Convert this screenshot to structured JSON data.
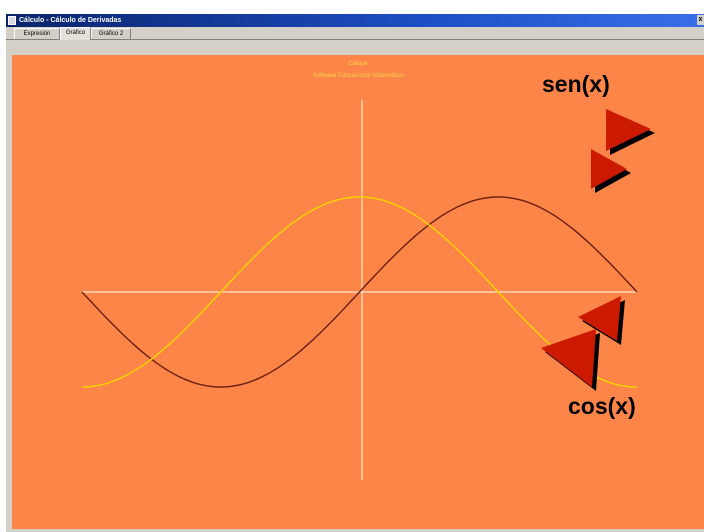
{
  "window": {
    "title": "Cálculo - Cálculo de Derivadas",
    "close_label": "x"
  },
  "tabs": [
    {
      "label": "Expresión",
      "active": false
    },
    {
      "label": "Gráfico",
      "active": true
    },
    {
      "label": "Gráfico 2",
      "active": false
    }
  ],
  "canvas": {
    "header_line1": "Calque",
    "header_line2": "Software Educacional Matemática",
    "background": "#fd8547"
  },
  "labels": {
    "sen": "sen(x)",
    "cos": "cos(x)"
  },
  "colors": {
    "sen_curve": "#6b1f10",
    "cos_curve": "#ffd400",
    "axes": "#ffe6c8",
    "arrow": "#cc1a00",
    "arrow_shadow": "#000000"
  },
  "chart_data": {
    "type": "line",
    "title": "",
    "xlabel": "",
    "ylabel": "",
    "x_range": [
      -3.1416,
      3.1416
    ],
    "y_range": [
      -1,
      1
    ],
    "grid": false,
    "series": [
      {
        "name": "sen(x)",
        "function": "sin"
      },
      {
        "name": "cos(x)",
        "function": "cos"
      }
    ]
  }
}
